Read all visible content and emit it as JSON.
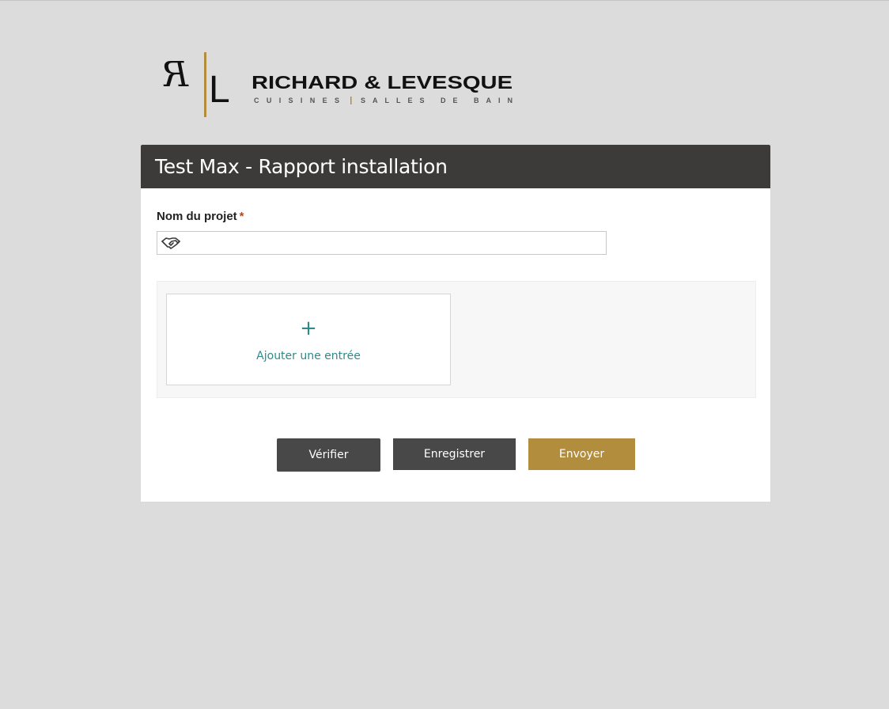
{
  "brand": {
    "monogram_left": "R",
    "monogram_right": "L",
    "name": "RICHARD & LEVESQUE",
    "tagline_left": "CUISINES",
    "tagline_right": "SALLES DE BAIN",
    "accent_color": "#b38d3e"
  },
  "form": {
    "title": "Test Max - Rapport installation",
    "header_color": "#3d3b39",
    "project_field": {
      "label": "Nom du projet",
      "required_marker": "*",
      "value": "",
      "icon": "handshake-icon"
    },
    "repeater": {
      "plus": "+",
      "add_label": "Ajouter une entrée",
      "accent_color": "#2f8a8a"
    },
    "buttons": {
      "verify": "Vérifier",
      "save": "Enregistrer",
      "send": "Envoyer"
    }
  }
}
